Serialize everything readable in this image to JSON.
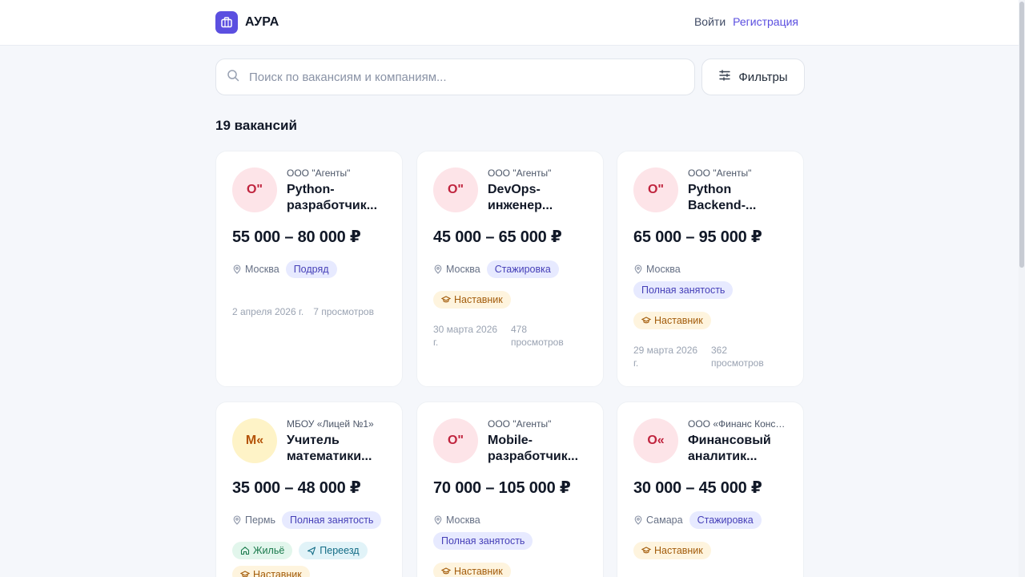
{
  "header": {
    "brand": "АУРА",
    "login": "Войти",
    "register": "Регистрация"
  },
  "search": {
    "placeholder": "Поиск по вакансиям и компаниям...",
    "filters_label": "Фильтры"
  },
  "results": {
    "count_label": "19 вакансий"
  },
  "colors": {
    "accent": "#5b4fe0",
    "background": "#f5f7fb"
  },
  "jobs": [
    {
      "initials": "О\"",
      "company": "ООО \"Агенты\"",
      "title": "Python-разработчик...",
      "salary": "55 000 – 80 000 ₽",
      "city": "Москва",
      "employment": "Подряд",
      "mentor": "",
      "date": "2 апреля 2026 г.",
      "views": "7 просмотров"
    },
    {
      "initials": "О\"",
      "company": "ООО \"Агенты\"",
      "title": "DevOps-инженер...",
      "salary": "45 000 – 65 000 ₽",
      "city": "Москва",
      "employment": "Стажировка",
      "mentor": "Наставник",
      "date": "30 марта 2026 г.",
      "views": "478 просмотров"
    },
    {
      "initials": "О\"",
      "company": "ООО \"Агенты\"",
      "title": "Python Backend-...",
      "salary": "65 000 – 95 000 ₽",
      "city": "Москва",
      "employment": "Полная занятость",
      "mentor": "Наставник",
      "date": "29 марта 2026 г.",
      "views": "362 просмотров"
    },
    {
      "initials": "М«",
      "company": "МБОУ «Лицей №1»",
      "title": "Учитель математики...",
      "salary": "35 000 – 48 000 ₽",
      "city": "Пермь",
      "employment": "Полная занятость",
      "housing": "Жильё",
      "relocation": "Переезд",
      "mentor": "Наставник"
    },
    {
      "initials": "О\"",
      "company": "ООО \"Агенты\"",
      "title": "Mobile-разработчик...",
      "salary": "70 000 – 105 000 ₽",
      "city": "Москва",
      "employment": "Полная занятость",
      "mentor": "Наставник"
    },
    {
      "initials": "О«",
      "company": "ООО «Финанс Консалт»",
      "title": "Финансовый аналитик...",
      "salary": "30 000 – 45 000 ₽",
      "city": "Самара",
      "employment": "Стажировка",
      "mentor": "Наставник"
    }
  ]
}
